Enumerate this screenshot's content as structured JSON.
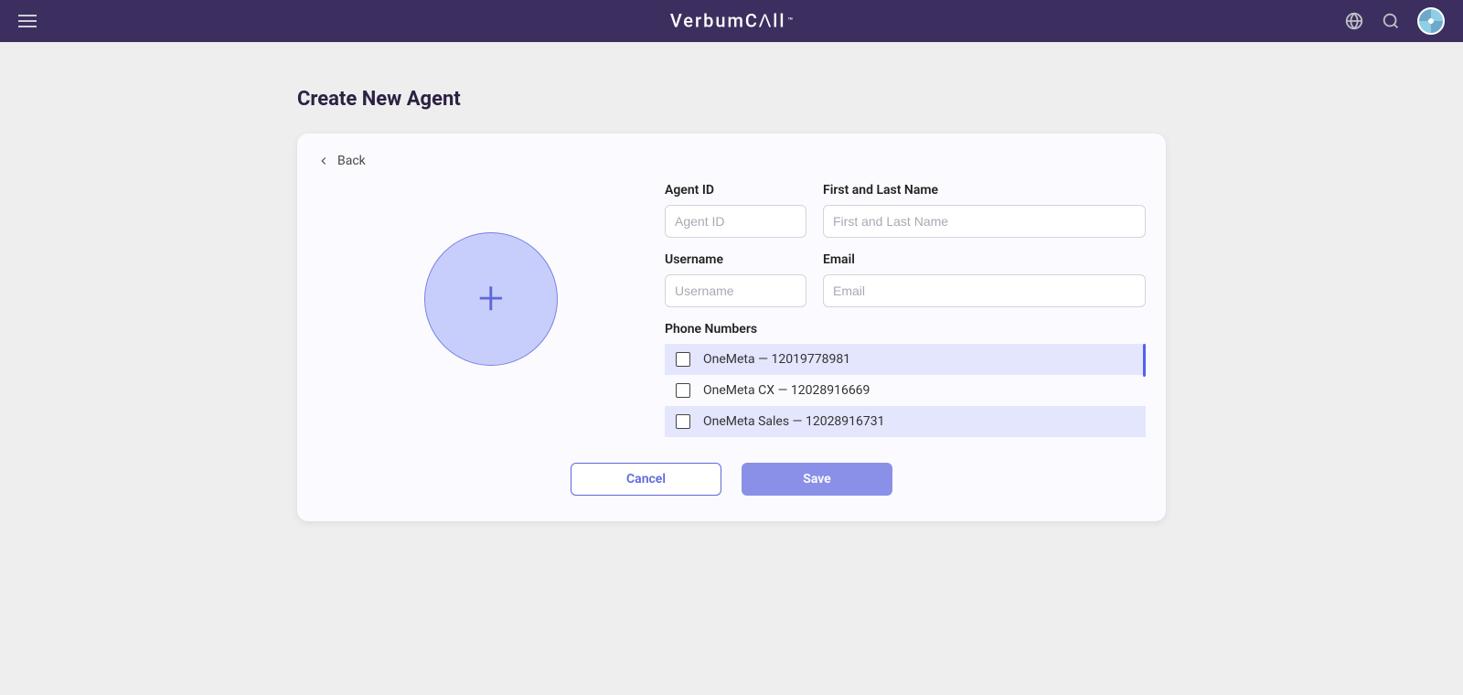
{
  "brand": {
    "name": "VerbumCɅll",
    "tm": "™"
  },
  "header": {
    "menu_icon": "menu-icon",
    "globe_icon": "globe-icon",
    "search_icon": "search-icon",
    "avatar": "user-avatar"
  },
  "page": {
    "title": "Create New Agent",
    "back_label": "Back"
  },
  "form": {
    "agent_id": {
      "label": "Agent ID",
      "placeholder": "Agent ID",
      "value": ""
    },
    "name": {
      "label": "First and Last Name",
      "placeholder": "First and Last Name",
      "value": ""
    },
    "username": {
      "label": "Username",
      "placeholder": "Username",
      "value": ""
    },
    "email": {
      "label": "Email",
      "placeholder": "Email",
      "value": ""
    },
    "phone_section_label": "Phone Numbers",
    "phone_numbers": [
      {
        "label": "OneMeta — 12019778981",
        "checked": false
      },
      {
        "label": "OneMeta CX — 12028916669",
        "checked": false
      },
      {
        "label": "OneMeta Sales — 12028916731",
        "checked": false
      }
    ]
  },
  "actions": {
    "cancel": "Cancel",
    "save": "Save"
  }
}
